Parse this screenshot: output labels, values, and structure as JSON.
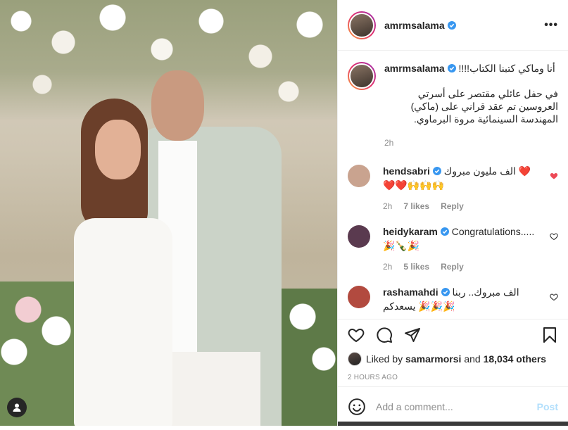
{
  "post": {
    "author": "amrmsalama",
    "more_label": "•••",
    "caption": {
      "headline": "أنا وماكي كتبنا الكتاب!!!!",
      "body": "في حفل عائلي مقتصر على أسرتي العروسين تم عقد قراني على (ماكي) المهندسة السينمائية مروة البرماوي.",
      "time": "2h"
    },
    "comments": [
      {
        "user": "hendsabri",
        "text": "الف مليون مبروك ❤️",
        "text_line2": "❤️❤️🙌🙌🙌",
        "time": "2h",
        "likes": "7 likes",
        "reply": "Reply",
        "liked": true,
        "avatar_color": "#c9a38f"
      },
      {
        "user": "heidykaram",
        "text": "Congratulations.....",
        "text_line2": "🎉🍾🎉",
        "time": "2h",
        "likes": "5 likes",
        "reply": "Reply",
        "liked": false,
        "avatar_color": "#5a3a4f"
      },
      {
        "user": "rashamahdi",
        "text": "الف مبروك.. ربنا",
        "text_line2": "يسعدكم 🎉🎉🎉",
        "time": "2h",
        "likes": "",
        "reply": "Reply",
        "liked": false,
        "avatar_color": "#b24a3f"
      }
    ],
    "liked_by_prefix": "Liked by",
    "liked_by_user": "samarmorsi",
    "liked_by_and": "and",
    "liked_by_others": "18,034 others",
    "timestamp": "2 HOURS AGO",
    "add_comment_placeholder": "Add a comment...",
    "post_button": "Post"
  },
  "colors": {
    "verified": "#3897f0",
    "like_red": "#ed4956",
    "muted": "#8e8e8e",
    "post_disabled": "#b2dffc"
  },
  "icons": {
    "like": "heart-icon",
    "comment": "comment-icon",
    "share": "share-icon",
    "save": "bookmark-icon",
    "emoji": "emoji-icon",
    "tag": "user-tag-icon",
    "verified": "verified-badge-icon"
  }
}
